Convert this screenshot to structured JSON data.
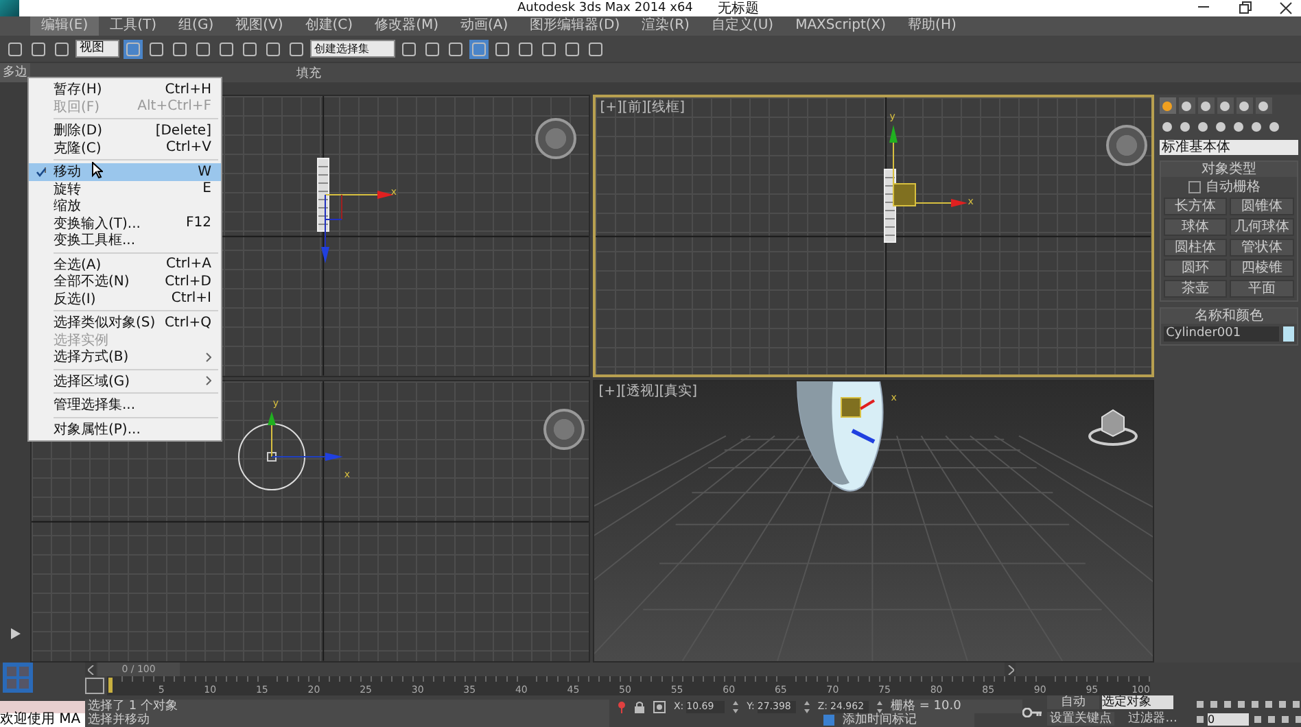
{
  "window": {
    "title": "Autodesk 3ds Max  2014 x64",
    "document": "无标题"
  },
  "menubar": [
    {
      "label": "编辑(E)",
      "selected": true
    },
    {
      "label": "工具(T)",
      "selected": false
    },
    {
      "label": "组(G)",
      "selected": false
    },
    {
      "label": "视图(V)",
      "selected": false
    },
    {
      "label": "创建(C)",
      "selected": false
    },
    {
      "label": "修改器(M)",
      "selected": false
    },
    {
      "label": "动画(A)",
      "selected": false
    },
    {
      "label": "图形编辑器(D)",
      "selected": false
    },
    {
      "label": "渲染(R)",
      "selected": false
    },
    {
      "label": "自定义(U)",
      "selected": false
    },
    {
      "label": "MAXScript(X)",
      "selected": false
    },
    {
      "label": "帮助(H)",
      "selected": false
    }
  ],
  "toolbar": {
    "view_dropdown": "视图",
    "selection_set": "创建选择集"
  },
  "ribbon": {
    "left_tab": "多边",
    "tab": "填充"
  },
  "edit_menu": [
    {
      "kind": "item",
      "label": "暂存(H)",
      "shortcut": "Ctrl+H",
      "checked": false,
      "selected": false,
      "disabled": false,
      "submenu": false
    },
    {
      "kind": "item",
      "label": "取回(F)",
      "shortcut": "Alt+Ctrl+F",
      "checked": false,
      "selected": false,
      "disabled": true,
      "submenu": false
    },
    {
      "kind": "separator"
    },
    {
      "kind": "item",
      "label": "删除(D)",
      "shortcut": "[Delete]",
      "checked": false,
      "selected": false,
      "disabled": false,
      "submenu": false
    },
    {
      "kind": "item",
      "label": "克隆(C)",
      "shortcut": "Ctrl+V",
      "checked": false,
      "selected": false,
      "disabled": false,
      "submenu": false
    },
    {
      "kind": "separator"
    },
    {
      "kind": "item",
      "label": "移动",
      "shortcut": "W",
      "checked": true,
      "selected": true,
      "disabled": false,
      "submenu": false
    },
    {
      "kind": "item",
      "label": "旋转",
      "shortcut": "E",
      "checked": false,
      "selected": false,
      "disabled": false,
      "submenu": false
    },
    {
      "kind": "item",
      "label": "缩放",
      "checked": false,
      "selected": false,
      "disabled": false,
      "submenu": false
    },
    {
      "kind": "item",
      "label": "变换输入(T)...",
      "shortcut": "F12",
      "checked": false,
      "selected": false,
      "disabled": false,
      "submenu": false
    },
    {
      "kind": "item",
      "label": "变换工具框...",
      "checked": false,
      "selected": false,
      "disabled": false,
      "submenu": false
    },
    {
      "kind": "separator"
    },
    {
      "kind": "item",
      "label": "全选(A)",
      "shortcut": "Ctrl+A",
      "checked": false,
      "selected": false,
      "disabled": false,
      "submenu": false
    },
    {
      "kind": "item",
      "label": "全部不选(N)",
      "shortcut": "Ctrl+D",
      "checked": false,
      "selected": false,
      "disabled": false,
      "submenu": false
    },
    {
      "kind": "item",
      "label": "反选(I)",
      "shortcut": "Ctrl+I",
      "checked": false,
      "selected": false,
      "disabled": false,
      "submenu": false
    },
    {
      "kind": "separator"
    },
    {
      "kind": "item",
      "label": "选择类似对象(S)",
      "shortcut": "Ctrl+Q",
      "checked": false,
      "selected": false,
      "disabled": false,
      "submenu": false
    },
    {
      "kind": "item",
      "label": "选择实例",
      "checked": false,
      "selected": false,
      "disabled": true,
      "submenu": false
    },
    {
      "kind": "item",
      "label": "选择方式(B)",
      "checked": false,
      "selected": false,
      "disabled": false,
      "submenu": true
    },
    {
      "kind": "separator"
    },
    {
      "kind": "item",
      "label": "选择区域(G)",
      "checked": false,
      "selected": false,
      "disabled": false,
      "submenu": true
    },
    {
      "kind": "separator"
    },
    {
      "kind": "item",
      "label": "管理选择集...",
      "checked": false,
      "selected": false,
      "disabled": false,
      "submenu": false
    },
    {
      "kind": "separator"
    },
    {
      "kind": "item",
      "label": "对象属性(P)...",
      "checked": false,
      "selected": false,
      "disabled": false,
      "submenu": false
    }
  ],
  "viewports": [
    {
      "kind": "side",
      "active": false,
      "axes": [
        "x"
      ]
    },
    {
      "kind": "front",
      "active": true,
      "label": "[+][前][线框]",
      "axes": [
        "y",
        "x"
      ]
    },
    {
      "kind": "top",
      "active": false,
      "axes": [
        "y",
        "x"
      ]
    },
    {
      "kind": "perspective",
      "active": false,
      "label": "[+][透视][真实]",
      "axes": [
        "x"
      ]
    }
  ],
  "command_panel": {
    "dropdown": "标准基本体",
    "object_type": {
      "title": "对象类型",
      "autogrid": {
        "label": "自动栅格",
        "checked": false
      },
      "buttons": [
        "长方体",
        "圆锥体",
        "球体",
        "几何球体",
        "圆柱体",
        "管状体",
        "圆环",
        "四棱锥",
        "茶壶",
        "平面"
      ]
    },
    "name_color": {
      "title": "名称和颜色",
      "name": "Cylinder001",
      "color": "#b8e2f2"
    }
  },
  "timeline": {
    "frame": "0 / 100",
    "ticks": [
      "5",
      "10",
      "15",
      "20",
      "25",
      "30",
      "35",
      "40",
      "45",
      "50",
      "55",
      "60",
      "65",
      "70",
      "75",
      "80",
      "85",
      "90",
      "95",
      "100"
    ]
  },
  "status": {
    "selection": "选择了 1 个对象",
    "prompt": "选择并移动",
    "welcome": "欢迎使用 MA",
    "coords": [
      {
        "axis": "X:",
        "value": "10.69"
      },
      {
        "axis": "Y:",
        "value": "27.398"
      },
      {
        "axis": "Z:",
        "value": "24.962"
      }
    ],
    "grid": "栅格 = 10.0",
    "add_tag": "添加时间标记",
    "auto_key": "自动",
    "key_mode": "选定对象",
    "set_key": "设置关键点",
    "filters": "过滤器...",
    "frame_field": "0"
  }
}
